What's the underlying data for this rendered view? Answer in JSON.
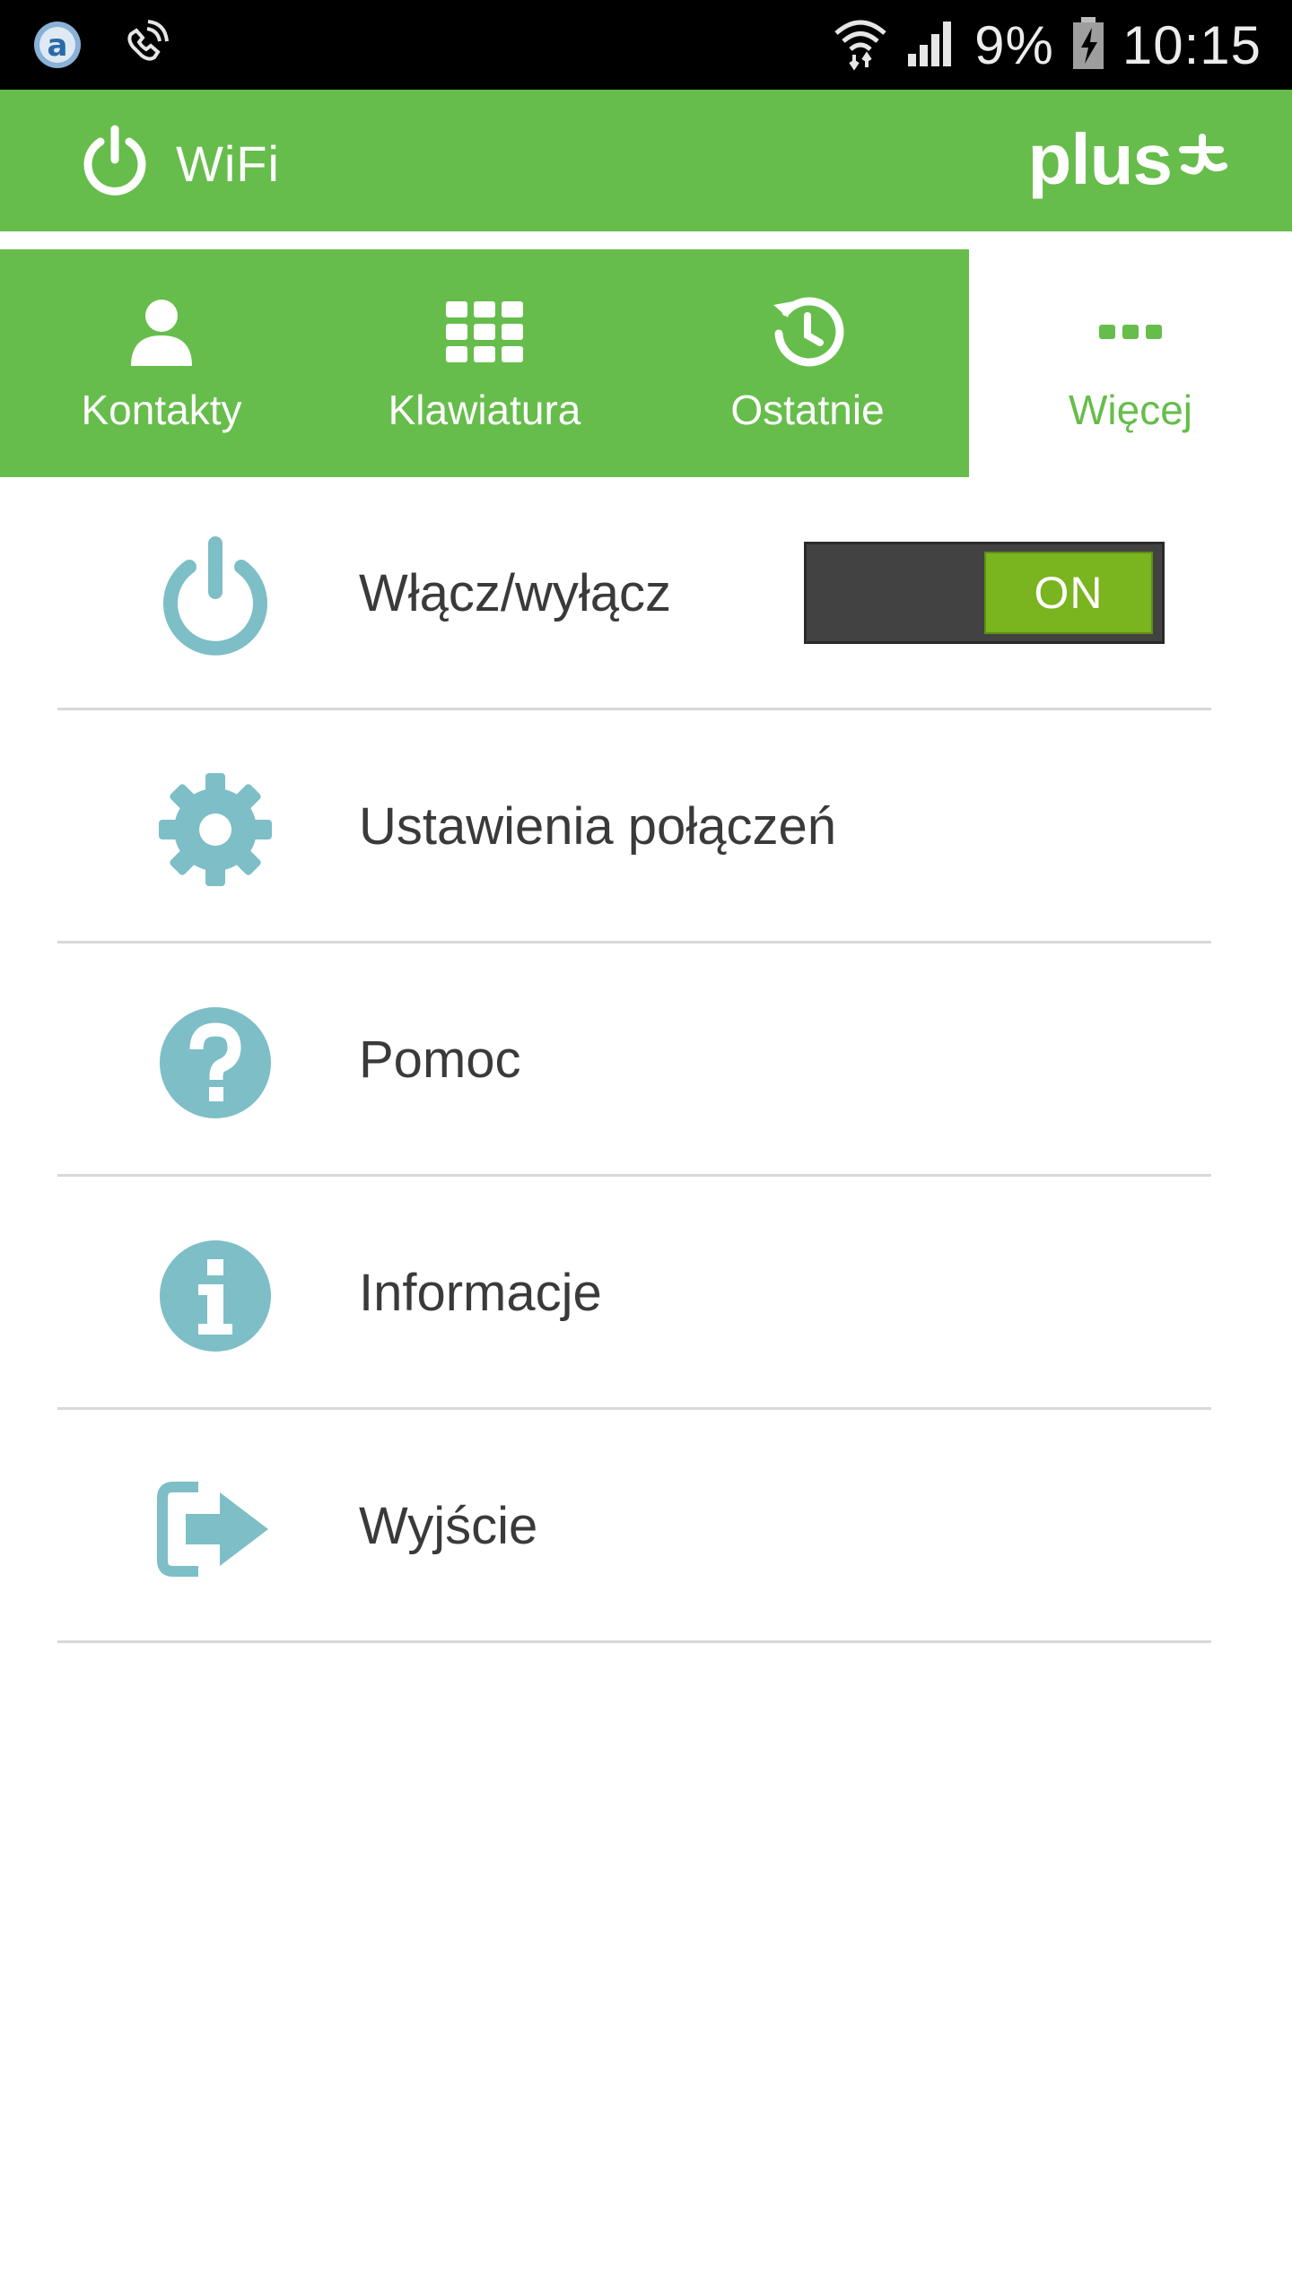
{
  "status_bar": {
    "battery_percent": "9%",
    "time": "10:15",
    "icons": [
      "app-a-icon",
      "wifi-calling-icon",
      "wifi-signal-icon",
      "cell-signal-icon",
      "battery-charging-icon"
    ]
  },
  "app_bar": {
    "title": "WiFi",
    "brand": "plus",
    "icons": [
      "power-icon",
      "plus-logo-icon"
    ]
  },
  "tabs": [
    {
      "label": "Kontakty",
      "icon": "person-icon",
      "active": false
    },
    {
      "label": "Klawiatura",
      "icon": "keypad-icon",
      "active": false
    },
    {
      "label": "Ostatnie",
      "icon": "history-icon",
      "active": false
    },
    {
      "label": "Więcej",
      "icon": "more-icon",
      "active": true
    }
  ],
  "menu": {
    "items": [
      {
        "label": "Włącz/wyłącz",
        "icon": "power-icon",
        "toggle": "ON"
      },
      {
        "label": "Ustawienia połączeń",
        "icon": "gear-icon"
      },
      {
        "label": "Pomoc",
        "icon": "help-icon"
      },
      {
        "label": "Informacje",
        "icon": "info-icon"
      },
      {
        "label": "Wyjście",
        "icon": "exit-icon"
      }
    ]
  },
  "colors": {
    "brand_green": "#66bd4b",
    "icon_teal": "#7dbec7",
    "toggle_on": "#7ab41e",
    "toggle_bg": "#424242"
  }
}
